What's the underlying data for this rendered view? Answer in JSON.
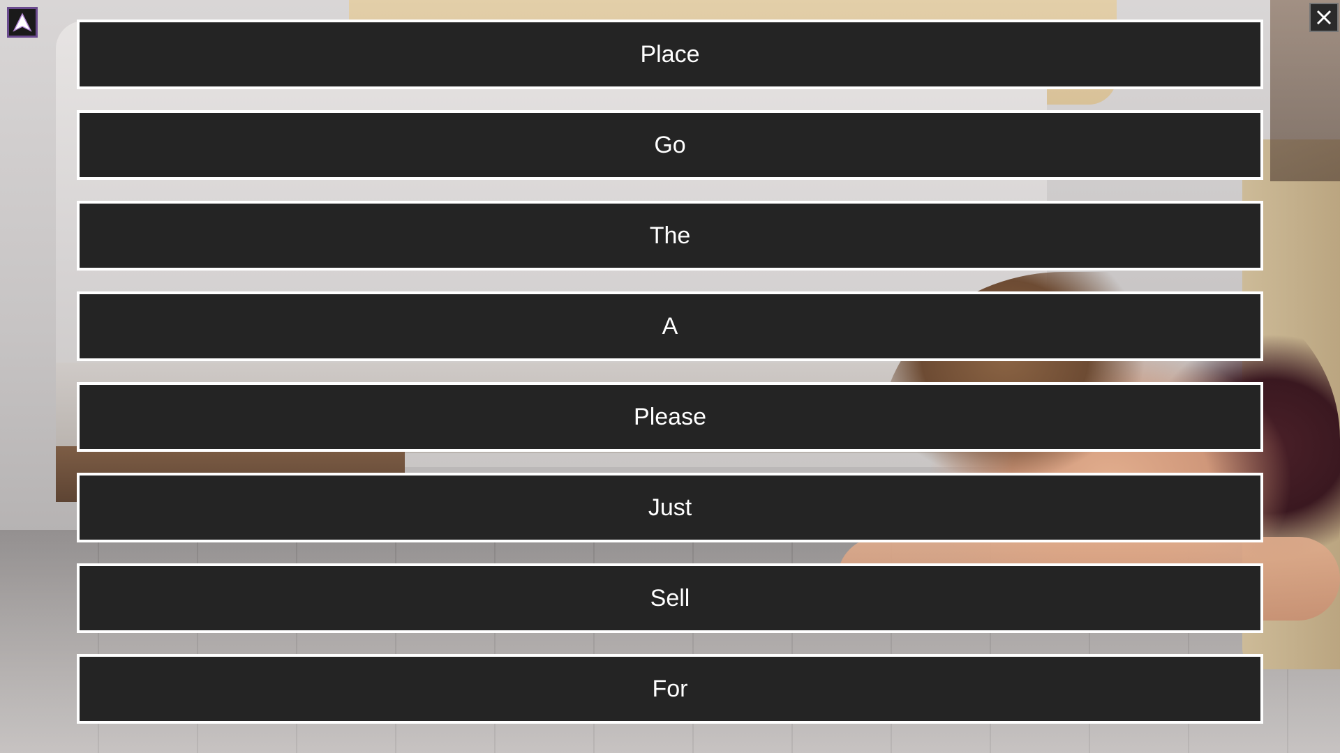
{
  "menu": {
    "choices": [
      {
        "label": "Place"
      },
      {
        "label": "Go"
      },
      {
        "label": "The"
      },
      {
        "label": "A"
      },
      {
        "label": "Please"
      },
      {
        "label": "Just"
      },
      {
        "label": "Sell"
      },
      {
        "label": "For"
      }
    ]
  },
  "icons": {
    "app": "arrow-up-triangle-icon",
    "close": "close-icon"
  },
  "colors": {
    "button_bg": "#242424",
    "button_border": "#ffffff",
    "button_text": "#ffffff",
    "app_icon_accent": "#6a4a8e"
  }
}
